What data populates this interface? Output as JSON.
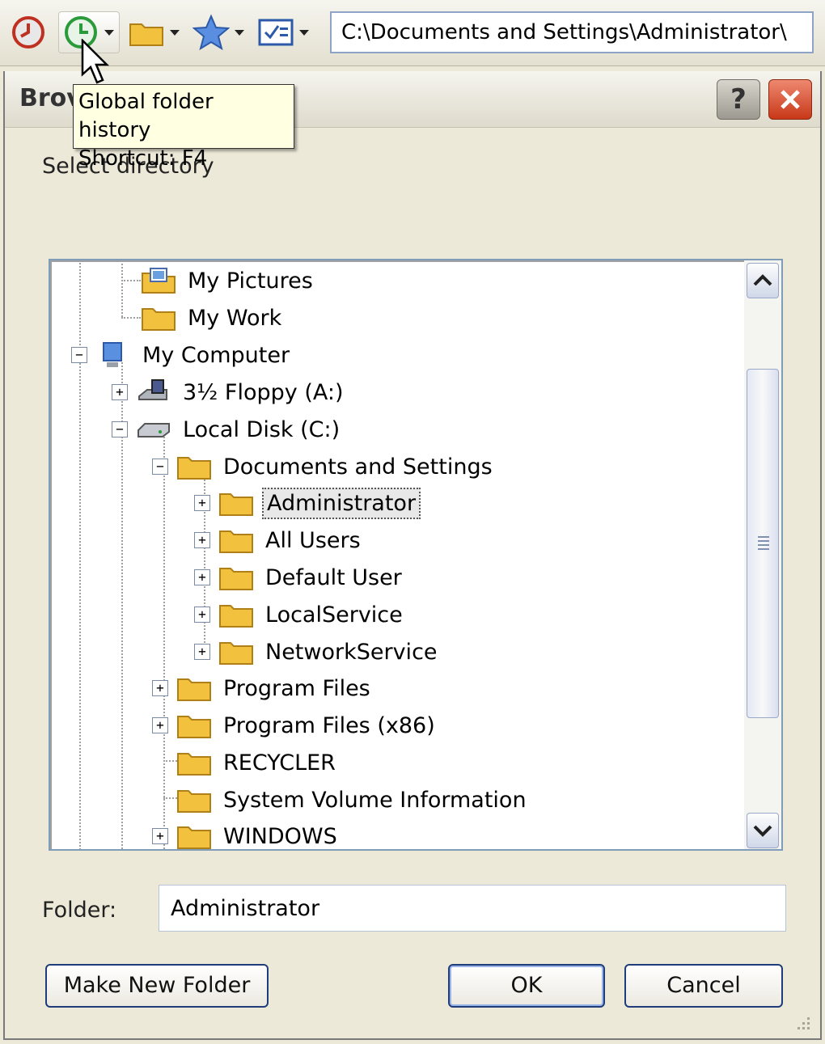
{
  "toolbar": {
    "address": "C:\\Documents and Settings\\Administrator\\"
  },
  "tooltip": {
    "line1": "Global folder history",
    "line2": "Shortcut: F4"
  },
  "dialog": {
    "title": "Brov",
    "help": "?",
    "prompt": "Select directory"
  },
  "tree": [
    {
      "label": "My Pictures"
    },
    {
      "label": "My Work"
    },
    {
      "label": "My Computer",
      "expander": "−"
    },
    {
      "label": "3½ Floppy (A:)",
      "expander": "+"
    },
    {
      "label": "Local Disk (C:)",
      "expander": "−"
    },
    {
      "label": "Documents and Settings",
      "expander": "−"
    },
    {
      "label": "Administrator",
      "expander": "+"
    },
    {
      "label": "All Users",
      "expander": "+"
    },
    {
      "label": "Default User",
      "expander": "+"
    },
    {
      "label": "LocalService",
      "expander": "+"
    },
    {
      "label": "NetworkService",
      "expander": "+"
    },
    {
      "label": "Program Files",
      "expander": "+"
    },
    {
      "label": "Program Files (x86)",
      "expander": "+"
    },
    {
      "label": "RECYCLER"
    },
    {
      "label": "System Volume Information"
    },
    {
      "label": "WINDOWS",
      "expander": "+"
    }
  ],
  "folder": {
    "label": "Folder:",
    "value": "Administrator"
  },
  "buttons": {
    "make_new_folder": "Make New Folder",
    "ok": "OK",
    "cancel": "Cancel"
  },
  "colors": {
    "folder": "#f2c23e",
    "selection_focus": "#555555",
    "close": "#c83818"
  }
}
